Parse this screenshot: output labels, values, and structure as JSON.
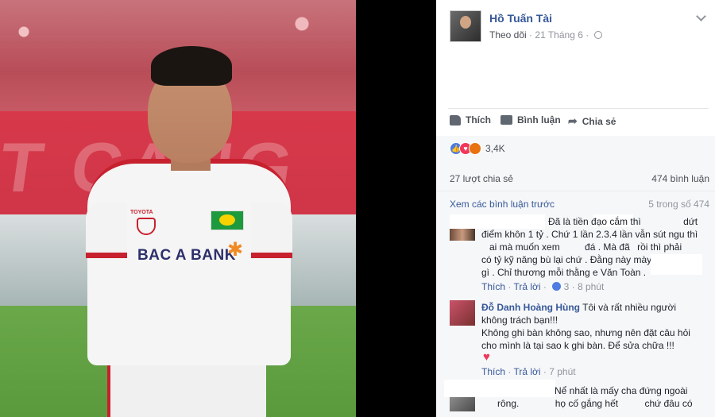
{
  "post": {
    "author": "Hồ Tuấn Tài",
    "follow": "Theo dõi",
    "date": "21 Tháng 6",
    "actions": {
      "like": "Thích",
      "comment": "Bình luận",
      "share": "Chia sẻ"
    },
    "reactions_count": "3,4K",
    "shares": "27 lượt chia sẻ",
    "comments_count": "474 bình luận",
    "view_previous": "Xem các bình luận trước",
    "page_count": "5 trong số 474",
    "photo_banner_text": "T CẢNG",
    "photo_sponsor": "BAC A BANK",
    "photo_toyota": "TOYOTA"
  },
  "comments": [
    {
      "lines": [
        "Đã là tiền đạo cắm thì",
        "dứt",
        "điểm khôn 1 tỷ . Chứ 1 lần 2.3.4 lần vẫn sút ngu thì",
        "ai mà muốn xem",
        "đá . Mà đã",
        "rồi thì phải",
        "có tỷ kỹ năng bù lại chứ . Đằng này mày chả có",
        "gì . Chỉ thương mỗi thằng e Văn Toàn ."
      ],
      "like": "Thích",
      "reply": "Trả lời",
      "likes": "3",
      "time": "8 phút"
    },
    {
      "name": "Đỗ Danh Hoàng Hùng",
      "lines": [
        "Tôi và rất nhiều người",
        "không trách bạn!!!",
        "Không ghi bàn không sao, nhưng nên đặt câu hỏi",
        "cho mình là tại sao k ghi bàn. Để sửa chữa !!!"
      ],
      "like": "Thích",
      "reply": "Trả lời",
      "time": "7 phút"
    },
    {
      "lines": [
        "Nể nhất là mấy cha đứng ngoài",
        "rông.",
        "họ cố gắng hết",
        "chứ đâu có"
      ]
    }
  ],
  "colors": {
    "link": "#365899",
    "text": "#1d2129",
    "meta": "#90949c",
    "like_blue": "#4d7ce2",
    "love_red": "#f0375a"
  }
}
